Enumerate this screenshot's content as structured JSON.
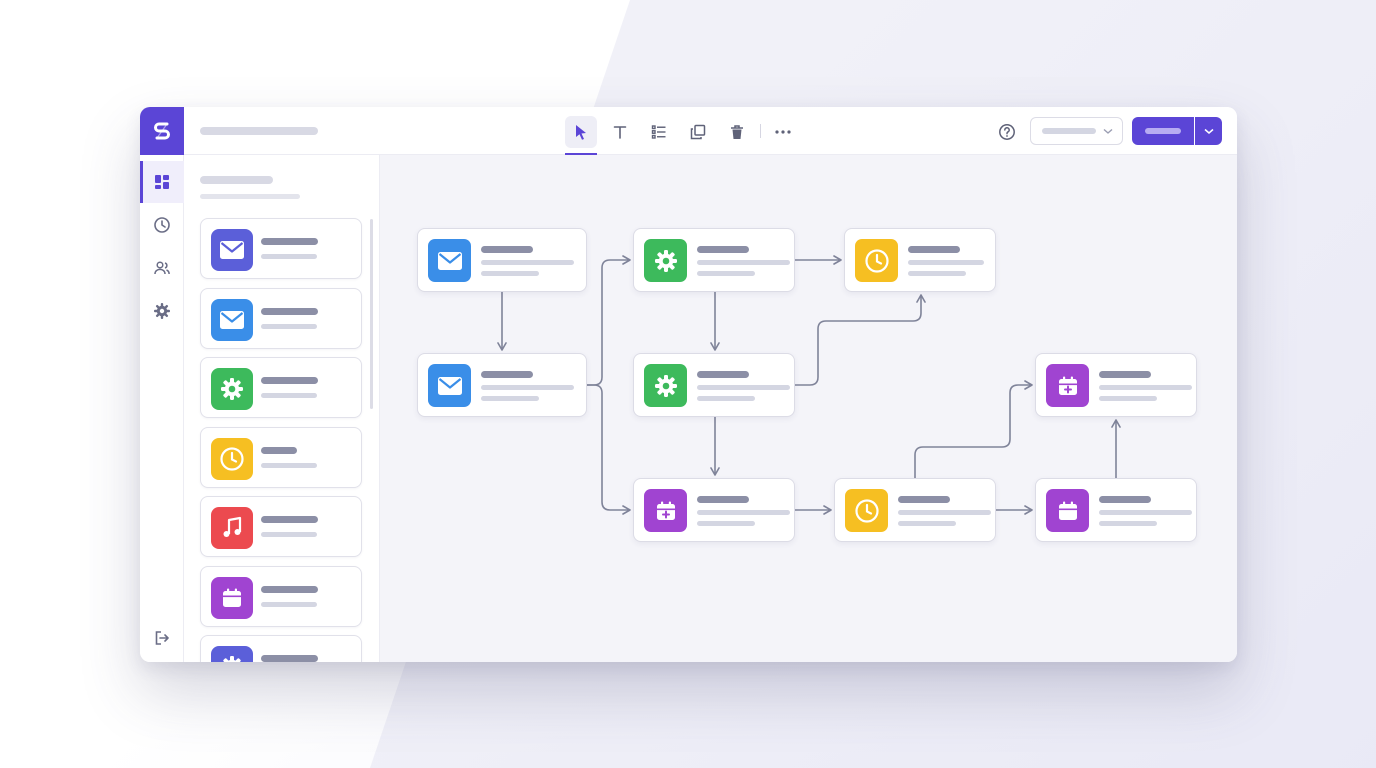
{
  "colors": {
    "accent": "#5b45d6",
    "mail_indigo": "#5b5fd9",
    "mail_blue": "#3a8ee8",
    "gear_green": "#3dba5c",
    "clock_yellow": "#f6bf22",
    "music_red": "#ec4a4f",
    "calendar_purple": "#a044d1",
    "wire": "#7f8399"
  },
  "app": {
    "logo_icon": "s-logo-icon"
  },
  "rail": {
    "items": [
      {
        "icon": "dashboard-icon",
        "active": true
      },
      {
        "icon": "history-icon",
        "active": false
      },
      {
        "icon": "users-icon",
        "active": false
      },
      {
        "icon": "settings-icon",
        "active": false
      }
    ],
    "footer_icon": "logout-icon"
  },
  "toolbar": {
    "tools": [
      "pointer-icon",
      "text-icon",
      "list-icon",
      "duplicate-icon",
      "trash-icon",
      "more-icon"
    ],
    "active_tool": "pointer-icon",
    "help_icon": "help-icon",
    "select_icon": "chevron-down-icon",
    "primary_drop_icon": "chevron-down-icon"
  },
  "panel": {
    "cards": [
      {
        "icon": "mail-icon",
        "color": "#5b5fd9"
      },
      {
        "icon": "mail-icon",
        "color": "#3a8ee8"
      },
      {
        "icon": "gear-icon",
        "color": "#3dba5c"
      },
      {
        "icon": "clock-icon",
        "color": "#f6bf22"
      },
      {
        "icon": "music-icon",
        "color": "#ec4a4f"
      },
      {
        "icon": "calendar-icon",
        "color": "#a044d1"
      },
      {
        "icon": "gear-icon",
        "color": "#5b5fd9"
      }
    ]
  },
  "flow": {
    "nodes": [
      {
        "id": "n1",
        "icon": "mail-icon",
        "color": "#3a8ee8"
      },
      {
        "id": "n2",
        "icon": "gear-icon",
        "color": "#3dba5c"
      },
      {
        "id": "n3",
        "icon": "clock-icon",
        "color": "#f6bf22"
      },
      {
        "id": "n4",
        "icon": "mail-icon",
        "color": "#3a8ee8"
      },
      {
        "id": "n5",
        "icon": "gear-icon",
        "color": "#3dba5c"
      },
      {
        "id": "n6",
        "icon": "calendar-add-icon",
        "color": "#a044d1"
      },
      {
        "id": "n7",
        "icon": "calendar-add-icon",
        "color": "#a044d1"
      },
      {
        "id": "n8",
        "icon": "clock-icon",
        "color": "#f6bf22"
      },
      {
        "id": "n9",
        "icon": "calendar-icon",
        "color": "#a044d1"
      }
    ],
    "edges": [
      [
        "n1",
        "n4"
      ],
      [
        "n4",
        "n2"
      ],
      [
        "n4",
        "n7"
      ],
      [
        "n2",
        "n3"
      ],
      [
        "n2",
        "n5"
      ],
      [
        "n5",
        "n3"
      ],
      [
        "n5",
        "n7"
      ],
      [
        "n7",
        "n8"
      ],
      [
        "n8",
        "n9"
      ],
      [
        "n8",
        "n6"
      ],
      [
        "n9",
        "n6"
      ]
    ]
  }
}
